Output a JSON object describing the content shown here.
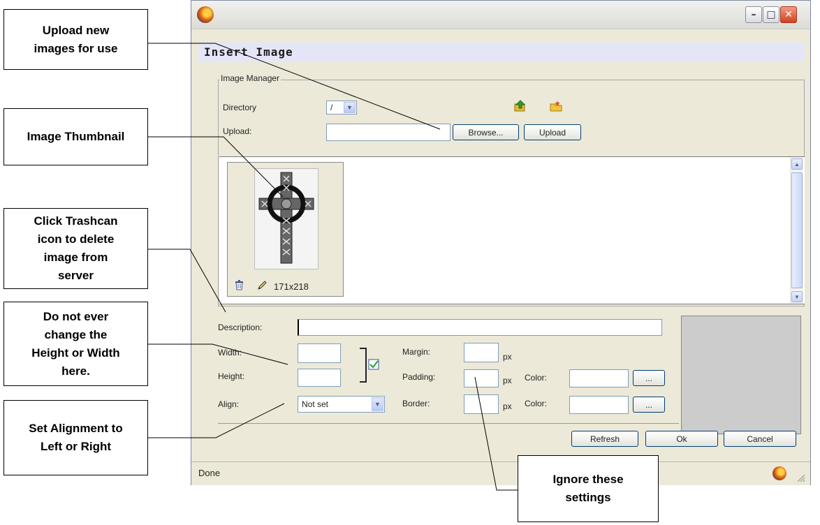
{
  "callouts": {
    "upload": "Upload new\nimages for use",
    "thumbnail": "Image Thumbnail",
    "trashcan": "Click Trashcan\nicon to delete\nimage from\nserver",
    "height_width": "Do not ever\nchange the\nHeight or Width\nhere.",
    "alignment": "Set Alignment to\nLeft or Right",
    "ignore": "Ignore these\nsettings"
  },
  "window": {
    "controls": {
      "minimize": "–",
      "maximize": "□",
      "close": "✕"
    },
    "dialog_title": "Insert Image"
  },
  "image_manager": {
    "legend": "Image Manager",
    "directory_label": "Directory",
    "directory_value": "/",
    "upload_label": "Upload:",
    "browse_button": "Browse...",
    "upload_button": "Upload",
    "thumb_info": "171x218"
  },
  "properties": {
    "description_label": "Description:",
    "description_value": "",
    "width_label": "Width:",
    "height_label": "Height:",
    "align_label": "Align:",
    "align_value": "Not set",
    "margin_label": "Margin:",
    "padding_label": "Padding:",
    "border_label": "Border:",
    "px": "px",
    "color_label": "Color:",
    "color_button": "..."
  },
  "buttons": {
    "refresh": "Refresh",
    "ok": "Ok",
    "cancel": "Cancel"
  },
  "statusbar": {
    "text": "Done"
  },
  "colors": {
    "title_band": "#e4e6f8",
    "window_bg": "#ece9d8",
    "preview": "#cccccc"
  }
}
